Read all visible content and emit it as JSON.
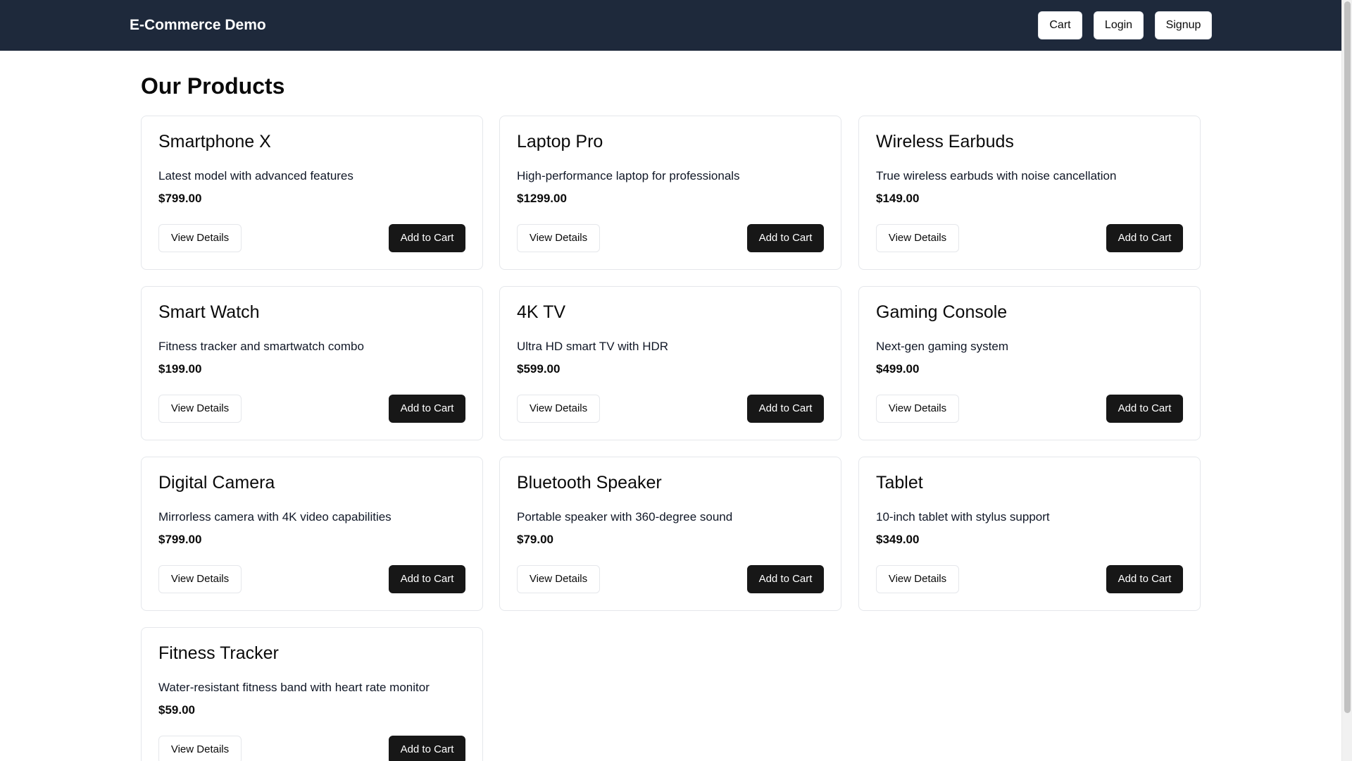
{
  "navbar": {
    "brand": "E-Commerce Demo",
    "cart_label": "Cart",
    "login_label": "Login",
    "signup_label": "Signup"
  },
  "main": {
    "title": "Our Products",
    "view_details_label": "View Details",
    "add_to_cart_label": "Add to Cart"
  },
  "products": [
    {
      "name": "Smartphone X",
      "description": "Latest model with advanced features",
      "price": "$799.00"
    },
    {
      "name": "Laptop Pro",
      "description": "High-performance laptop for professionals",
      "price": "$1299.00"
    },
    {
      "name": "Wireless Earbuds",
      "description": "True wireless earbuds with noise cancellation",
      "price": "$149.00"
    },
    {
      "name": "Smart Watch",
      "description": "Fitness tracker and smartwatch combo",
      "price": "$199.00"
    },
    {
      "name": "4K TV",
      "description": "Ultra HD smart TV with HDR",
      "price": "$599.00"
    },
    {
      "name": "Gaming Console",
      "description": "Next-gen gaming system",
      "price": "$499.00"
    },
    {
      "name": "Digital Camera",
      "description": "Mirrorless camera with 4K video capabilities",
      "price": "$799.00"
    },
    {
      "name": "Bluetooth Speaker",
      "description": "Portable speaker with 360-degree sound",
      "price": "$79.00"
    },
    {
      "name": "Tablet",
      "description": "10-inch tablet with stylus support",
      "price": "$349.00"
    },
    {
      "name": "Fitness Tracker",
      "description": "Water-resistant fitness band with heart rate monitor",
      "price": "$59.00"
    }
  ]
}
